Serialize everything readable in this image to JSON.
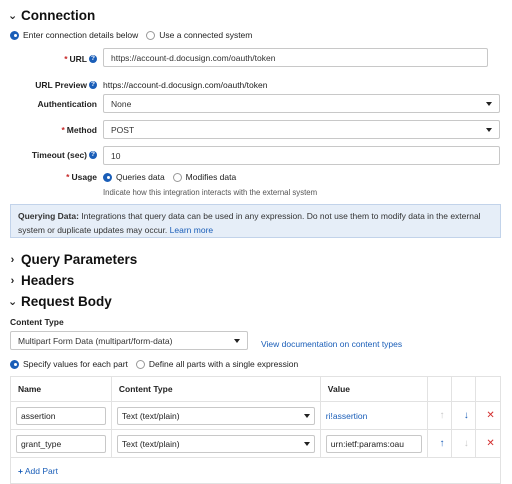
{
  "connection": {
    "title": "Connection",
    "radio_manual": "Enter connection details below",
    "radio_system": "Use a connected system",
    "url_label": "URL",
    "url_value": "https://account-d.docusign.com/oauth/token",
    "preview_label": "URL Preview",
    "preview_value": "https://account-d.docusign.com/oauth/token",
    "auth_label": "Authentication",
    "auth_value": "None",
    "method_label": "Method",
    "method_value": "POST",
    "timeout_label": "Timeout (sec)",
    "timeout_value": "10",
    "usage_label": "Usage",
    "usage_queries": "Queries data",
    "usage_modifies": "Modifies data",
    "usage_hint": "Indicate how this integration interacts with the external system",
    "banner_bold": "Querying Data:",
    "banner_text_line1": " Integrations that query data can be used in any expression. Do not use them to modify data in the external",
    "banner_text_line2": "system or duplicate updates may occur. ",
    "banner_link": "Learn more"
  },
  "sections": {
    "query_params": "Query Parameters",
    "headers": "Headers",
    "request_body": "Request Body"
  },
  "body": {
    "content_type_label": "Content Type",
    "content_type_value": "Multipart Form Data (multipart/form-data)",
    "doc_link": "View documentation on content types",
    "radio_each": "Specify values for each part",
    "radio_single": "Define all parts with a single expression",
    "col_name": "Name",
    "col_content_type": "Content Type",
    "col_value": "Value",
    "rows": [
      {
        "name": "assertion",
        "content_type": "Text (text/plain)",
        "value": "ri!assertion"
      },
      {
        "name": "grant_type",
        "content_type": "Text (text/plain)",
        "value": "urn:ietf:params:oau"
      }
    ],
    "add_part": "Add Part"
  },
  "colors": {
    "accent": "#1a5eb8",
    "danger": "#d32f2f",
    "banner_bg": "#e6eef8"
  },
  "icons": [
    "chevron-down-icon",
    "chevron-right-icon",
    "help-icon",
    "arrow-up-icon",
    "arrow-down-icon",
    "delete-icon",
    "plus-icon"
  ]
}
